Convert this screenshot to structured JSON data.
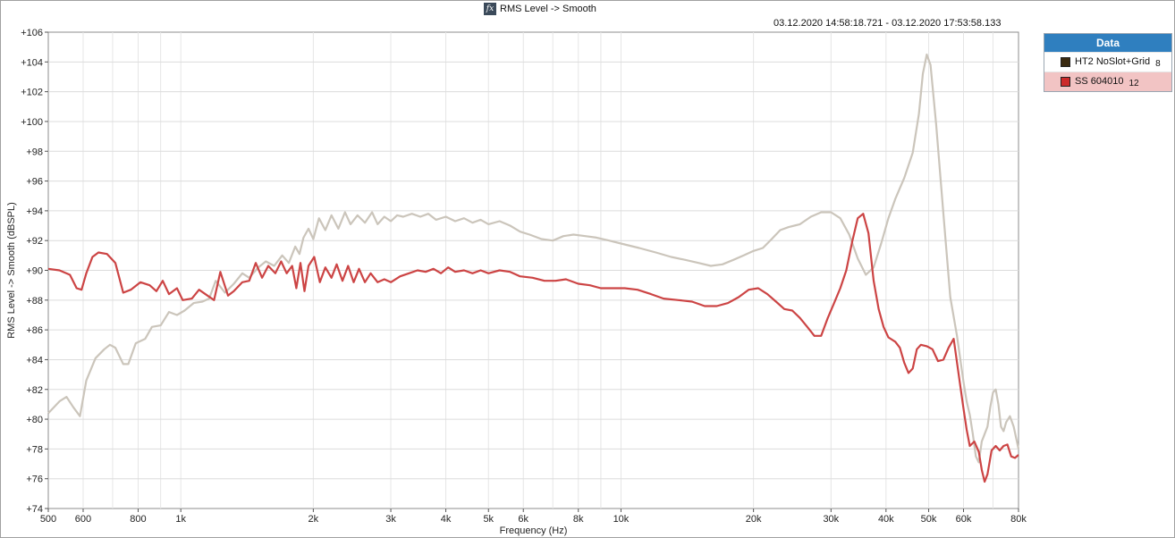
{
  "window": {
    "title": "RMS Level -> Smooth",
    "date_range": "03.12.2020 14:58:18.721 - 03.12.2020 17:53:58.133",
    "logo_text": "AP"
  },
  "legend": {
    "header": "Data",
    "items": [
      {
        "name": "HT2 NoSlot+Grid",
        "number": "8",
        "color": "#3a2a10",
        "selected": false
      },
      {
        "name": "SS 604010",
        "number": "12",
        "color": "#cc2a2a",
        "selected": true
      }
    ]
  },
  "chart_data": {
    "type": "line",
    "title": "RMS Level -> Smooth",
    "xlabel": "Frequency (Hz)",
    "ylabel": "RMS Level -> Smooth (dBSPL)",
    "xscale": "log",
    "xlim": [
      500,
      80000
    ],
    "ylim": [
      74,
      106
    ],
    "grid": true,
    "legend_position": "right",
    "x_ticks": [
      {
        "value": 500,
        "label": "500"
      },
      {
        "value": 600,
        "label": "600"
      },
      {
        "value": 800,
        "label": "800"
      },
      {
        "value": 1000,
        "label": "1k"
      },
      {
        "value": 2000,
        "label": "2k"
      },
      {
        "value": 3000,
        "label": "3k"
      },
      {
        "value": 4000,
        "label": "4k"
      },
      {
        "value": 5000,
        "label": "5k"
      },
      {
        "value": 6000,
        "label": "6k"
      },
      {
        "value": 8000,
        "label": "8k"
      },
      {
        "value": 10000,
        "label": "10k"
      },
      {
        "value": 20000,
        "label": "20k"
      },
      {
        "value": 30000,
        "label": "30k"
      },
      {
        "value": 40000,
        "label": "40k"
      },
      {
        "value": 50000,
        "label": "50k"
      },
      {
        "value": 60000,
        "label": "60k"
      },
      {
        "value": 80000,
        "label": "80k"
      }
    ],
    "y_ticks": [
      {
        "value": 106,
        "label": "+106"
      },
      {
        "value": 104,
        "label": "+104"
      },
      {
        "value": 102,
        "label": "+102"
      },
      {
        "value": 100,
        "label": "+100"
      },
      {
        "value": 98,
        "label": "+98"
      },
      {
        "value": 96,
        "label": "+96"
      },
      {
        "value": 94,
        "label": "+94"
      },
      {
        "value": 92,
        "label": "+92"
      },
      {
        "value": 90,
        "label": "+90"
      },
      {
        "value": 88,
        "label": "+88"
      },
      {
        "value": 86,
        "label": "+86"
      },
      {
        "value": 84,
        "label": "+84"
      },
      {
        "value": 82,
        "label": "+82"
      },
      {
        "value": 80,
        "label": "+80"
      },
      {
        "value": 78,
        "label": "+78"
      },
      {
        "value": 76,
        "label": "+76"
      },
      {
        "value": 74,
        "label": "+74"
      }
    ],
    "series": [
      {
        "name": "HT2 NoSlot+Grid",
        "color": "#cbc5bb",
        "points": [
          [
            500,
            80.4
          ],
          [
            530,
            81.2
          ],
          [
            550,
            81.5
          ],
          [
            570,
            80.8
          ],
          [
            590,
            80.2
          ],
          [
            610,
            82.6
          ],
          [
            640,
            84.1
          ],
          [
            670,
            84.7
          ],
          [
            690,
            85.0
          ],
          [
            710,
            84.8
          ],
          [
            740,
            83.7
          ],
          [
            760,
            83.7
          ],
          [
            790,
            85.1
          ],
          [
            830,
            85.4
          ],
          [
            860,
            86.2
          ],
          [
            900,
            86.3
          ],
          [
            940,
            87.2
          ],
          [
            980,
            87.0
          ],
          [
            1020,
            87.3
          ],
          [
            1070,
            87.8
          ],
          [
            1120,
            87.9
          ],
          [
            1160,
            88.1
          ],
          [
            1200,
            89.3
          ],
          [
            1260,
            88.5
          ],
          [
            1320,
            89.1
          ],
          [
            1380,
            89.8
          ],
          [
            1430,
            89.5
          ],
          [
            1500,
            90.2
          ],
          [
            1560,
            90.6
          ],
          [
            1630,
            90.3
          ],
          [
            1700,
            91.0
          ],
          [
            1760,
            90.5
          ],
          [
            1820,
            91.6
          ],
          [
            1860,
            91.1
          ],
          [
            1900,
            92.2
          ],
          [
            1950,
            92.8
          ],
          [
            2000,
            92.1
          ],
          [
            2060,
            93.5
          ],
          [
            2130,
            92.7
          ],
          [
            2200,
            93.7
          ],
          [
            2280,
            92.8
          ],
          [
            2360,
            93.9
          ],
          [
            2430,
            93.1
          ],
          [
            2520,
            93.7
          ],
          [
            2620,
            93.2
          ],
          [
            2720,
            93.9
          ],
          [
            2800,
            93.1
          ],
          [
            2900,
            93.6
          ],
          [
            3000,
            93.3
          ],
          [
            3100,
            93.7
          ],
          [
            3200,
            93.6
          ],
          [
            3350,
            93.8
          ],
          [
            3500,
            93.6
          ],
          [
            3650,
            93.8
          ],
          [
            3800,
            93.4
          ],
          [
            4000,
            93.6
          ],
          [
            4200,
            93.3
          ],
          [
            4400,
            93.5
          ],
          [
            4600,
            93.2
          ],
          [
            4800,
            93.4
          ],
          [
            5000,
            93.1
          ],
          [
            5300,
            93.3
          ],
          [
            5600,
            93.0
          ],
          [
            5900,
            92.6
          ],
          [
            6200,
            92.4
          ],
          [
            6600,
            92.1
          ],
          [
            7000,
            92.0
          ],
          [
            7400,
            92.3
          ],
          [
            7800,
            92.4
          ],
          [
            8300,
            92.3
          ],
          [
            8800,
            92.2
          ],
          [
            9400,
            92.0
          ],
          [
            10000,
            91.8
          ],
          [
            11000,
            91.5
          ],
          [
            12000,
            91.2
          ],
          [
            13000,
            90.9
          ],
          [
            14000,
            90.7
          ],
          [
            15000,
            90.5
          ],
          [
            16000,
            90.3
          ],
          [
            17000,
            90.4
          ],
          [
            18000,
            90.7
          ],
          [
            19000,
            91.0
          ],
          [
            20000,
            91.3
          ],
          [
            21000,
            91.5
          ],
          [
            22000,
            92.1
          ],
          [
            23000,
            92.7
          ],
          [
            24000,
            92.9
          ],
          [
            25500,
            93.1
          ],
          [
            27000,
            93.6
          ],
          [
            28500,
            93.9
          ],
          [
            30000,
            93.9
          ],
          [
            31500,
            93.5
          ],
          [
            33000,
            92.4
          ],
          [
            34500,
            90.8
          ],
          [
            36000,
            89.7
          ],
          [
            37500,
            90.2
          ],
          [
            39000,
            91.8
          ],
          [
            40500,
            93.5
          ],
          [
            42000,
            94.8
          ],
          [
            44000,
            96.2
          ],
          [
            46000,
            97.9
          ],
          [
            47500,
            100.5
          ],
          [
            48500,
            103.2
          ],
          [
            49500,
            104.5
          ],
          [
            50500,
            103.8
          ],
          [
            52000,
            99.8
          ],
          [
            54000,
            93.8
          ],
          [
            56000,
            88.2
          ],
          [
            58000,
            85.6
          ],
          [
            60000,
            82.5
          ],
          [
            61000,
            81.2
          ],
          [
            62000,
            80.3
          ],
          [
            63000,
            79.0
          ],
          [
            64000,
            77.5
          ],
          [
            65000,
            77.1
          ],
          [
            66000,
            78.5
          ],
          [
            67000,
            79.0
          ],
          [
            68000,
            79.5
          ],
          [
            69000,
            80.8
          ],
          [
            70000,
            81.8
          ],
          [
            71000,
            82.0
          ],
          [
            72000,
            81.0
          ],
          [
            73000,
            79.5
          ],
          [
            74000,
            79.2
          ],
          [
            75000,
            79.8
          ],
          [
            76500,
            80.2
          ],
          [
            78000,
            79.5
          ],
          [
            80000,
            78.0
          ]
        ]
      },
      {
        "name": "SS 604010",
        "color": "#cc4444",
        "points": [
          [
            500,
            90.1
          ],
          [
            530,
            90.0
          ],
          [
            560,
            89.7
          ],
          [
            580,
            88.8
          ],
          [
            595,
            88.7
          ],
          [
            610,
            89.8
          ],
          [
            630,
            90.9
          ],
          [
            650,
            91.2
          ],
          [
            680,
            91.1
          ],
          [
            710,
            90.5
          ],
          [
            740,
            88.5
          ],
          [
            770,
            88.7
          ],
          [
            810,
            89.2
          ],
          [
            850,
            89.0
          ],
          [
            880,
            88.6
          ],
          [
            910,
            89.3
          ],
          [
            940,
            88.4
          ],
          [
            980,
            88.8
          ],
          [
            1010,
            88.0
          ],
          [
            1060,
            88.1
          ],
          [
            1100,
            88.7
          ],
          [
            1150,
            88.3
          ],
          [
            1190,
            88.0
          ],
          [
            1230,
            89.9
          ],
          [
            1280,
            88.3
          ],
          [
            1320,
            88.6
          ],
          [
            1380,
            89.2
          ],
          [
            1430,
            89.3
          ],
          [
            1480,
            90.5
          ],
          [
            1530,
            89.5
          ],
          [
            1580,
            90.3
          ],
          [
            1640,
            89.8
          ],
          [
            1690,
            90.6
          ],
          [
            1740,
            89.8
          ],
          [
            1790,
            90.3
          ],
          [
            1830,
            88.8
          ],
          [
            1870,
            90.5
          ],
          [
            1910,
            88.6
          ],
          [
            1950,
            90.3
          ],
          [
            2010,
            90.9
          ],
          [
            2070,
            89.2
          ],
          [
            2130,
            90.2
          ],
          [
            2200,
            89.5
          ],
          [
            2260,
            90.4
          ],
          [
            2330,
            89.3
          ],
          [
            2400,
            90.3
          ],
          [
            2470,
            89.2
          ],
          [
            2540,
            90.1
          ],
          [
            2620,
            89.2
          ],
          [
            2700,
            89.8
          ],
          [
            2800,
            89.2
          ],
          [
            2900,
            89.4
          ],
          [
            3000,
            89.2
          ],
          [
            3150,
            89.6
          ],
          [
            3300,
            89.8
          ],
          [
            3450,
            90.0
          ],
          [
            3600,
            89.9
          ],
          [
            3750,
            90.1
          ],
          [
            3900,
            89.8
          ],
          [
            4050,
            90.2
          ],
          [
            4200,
            89.9
          ],
          [
            4400,
            90.0
          ],
          [
            4600,
            89.8
          ],
          [
            4800,
            90.0
          ],
          [
            5000,
            89.8
          ],
          [
            5300,
            90.0
          ],
          [
            5600,
            89.9
          ],
          [
            5900,
            89.6
          ],
          [
            6300,
            89.5
          ],
          [
            6700,
            89.3
          ],
          [
            7100,
            89.3
          ],
          [
            7500,
            89.4
          ],
          [
            8000,
            89.1
          ],
          [
            8500,
            89.0
          ],
          [
            9000,
            88.8
          ],
          [
            9600,
            88.8
          ],
          [
            10200,
            88.8
          ],
          [
            10900,
            88.7
          ],
          [
            11700,
            88.4
          ],
          [
            12500,
            88.1
          ],
          [
            13500,
            88.0
          ],
          [
            14500,
            87.9
          ],
          [
            15500,
            87.6
          ],
          [
            16500,
            87.6
          ],
          [
            17500,
            87.8
          ],
          [
            18500,
            88.2
          ],
          [
            19500,
            88.7
          ],
          [
            20500,
            88.8
          ],
          [
            21500,
            88.4
          ],
          [
            22500,
            87.9
          ],
          [
            23500,
            87.4
          ],
          [
            24500,
            87.3
          ],
          [
            25500,
            86.8
          ],
          [
            26500,
            86.2
          ],
          [
            27500,
            85.6
          ],
          [
            28500,
            85.6
          ],
          [
            29500,
            86.8
          ],
          [
            30500,
            87.8
          ],
          [
            31500,
            88.8
          ],
          [
            32500,
            90.0
          ],
          [
            33500,
            91.9
          ],
          [
            34500,
            93.5
          ],
          [
            35500,
            93.8
          ],
          [
            36500,
            92.5
          ],
          [
            37500,
            89.3
          ],
          [
            38500,
            87.4
          ],
          [
            39500,
            86.2
          ],
          [
            40500,
            85.5
          ],
          [
            42000,
            85.2
          ],
          [
            43000,
            84.8
          ],
          [
            44000,
            83.8
          ],
          [
            45000,
            83.1
          ],
          [
            46000,
            83.4
          ],
          [
            47000,
            84.7
          ],
          [
            48000,
            85.0
          ],
          [
            49500,
            84.9
          ],
          [
            51000,
            84.7
          ],
          [
            52500,
            83.9
          ],
          [
            54000,
            84.0
          ],
          [
            55500,
            84.8
          ],
          [
            57000,
            85.4
          ],
          [
            58500,
            83.0
          ],
          [
            60000,
            80.7
          ],
          [
            61000,
            79.3
          ],
          [
            62000,
            78.2
          ],
          [
            63500,
            78.5
          ],
          [
            65000,
            77.8
          ],
          [
            66000,
            76.6
          ],
          [
            67000,
            75.8
          ],
          [
            68000,
            76.3
          ],
          [
            69500,
            77.9
          ],
          [
            71000,
            78.2
          ],
          [
            72500,
            77.9
          ],
          [
            74000,
            78.2
          ],
          [
            75500,
            78.3
          ],
          [
            77000,
            77.5
          ],
          [
            78500,
            77.4
          ],
          [
            80000,
            77.6
          ]
        ]
      }
    ]
  }
}
